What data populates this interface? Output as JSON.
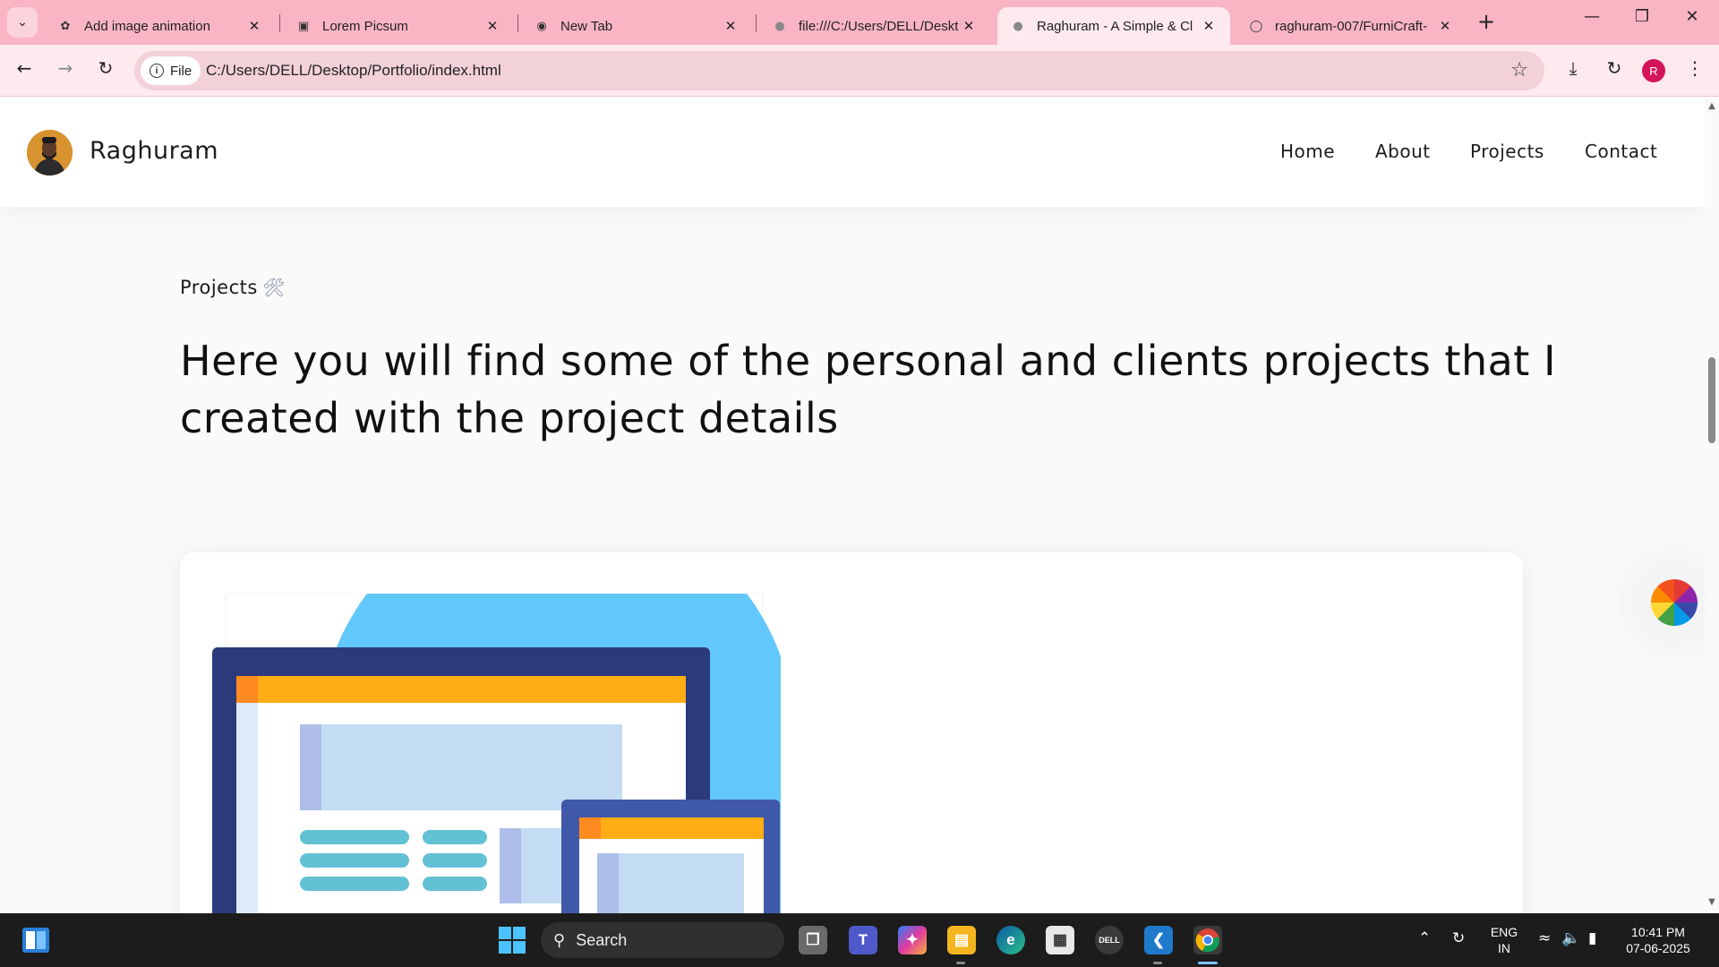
{
  "browser": {
    "tabs": [
      {
        "title": "Add image animation",
        "icon": "openai-icon"
      },
      {
        "title": "Lorem Picsum",
        "icon": "image-icon"
      },
      {
        "title": "New Tab",
        "icon": "chrome-icon"
      },
      {
        "title": "file:///C:/Users/DELL/Deskt",
        "icon": "globe-icon"
      },
      {
        "title": "Raghuram - A Simple & Cl",
        "icon": "globe-icon",
        "active": true
      },
      {
        "title": "raghuram-007/FurniCraft-",
        "icon": "github-icon"
      }
    ],
    "new_tab": "+",
    "chip_label": "File",
    "url": "C:/Users/DELL/Desktop/Portfolio/index.html",
    "profile_initial": "R"
  },
  "site": {
    "brand": "Raghuram",
    "nav": [
      "Home",
      "About",
      "Projects",
      "Contact"
    ],
    "section_label": "Projects",
    "headline": "Here you will find some of the personal and clients projects that I created with the project details"
  },
  "taskbar": {
    "search_label": "Search",
    "lang_top": "ENG",
    "lang_bottom": "IN",
    "time": "10:41 PM",
    "date": "07-06-2025"
  },
  "colors": {
    "tabstrip": "#f9b5c4",
    "toolbar": "#fde9ee",
    "illus_navy": "#2b3a7a",
    "illus_orange": "#ffad14",
    "illus_sky": "#62c8fb"
  }
}
